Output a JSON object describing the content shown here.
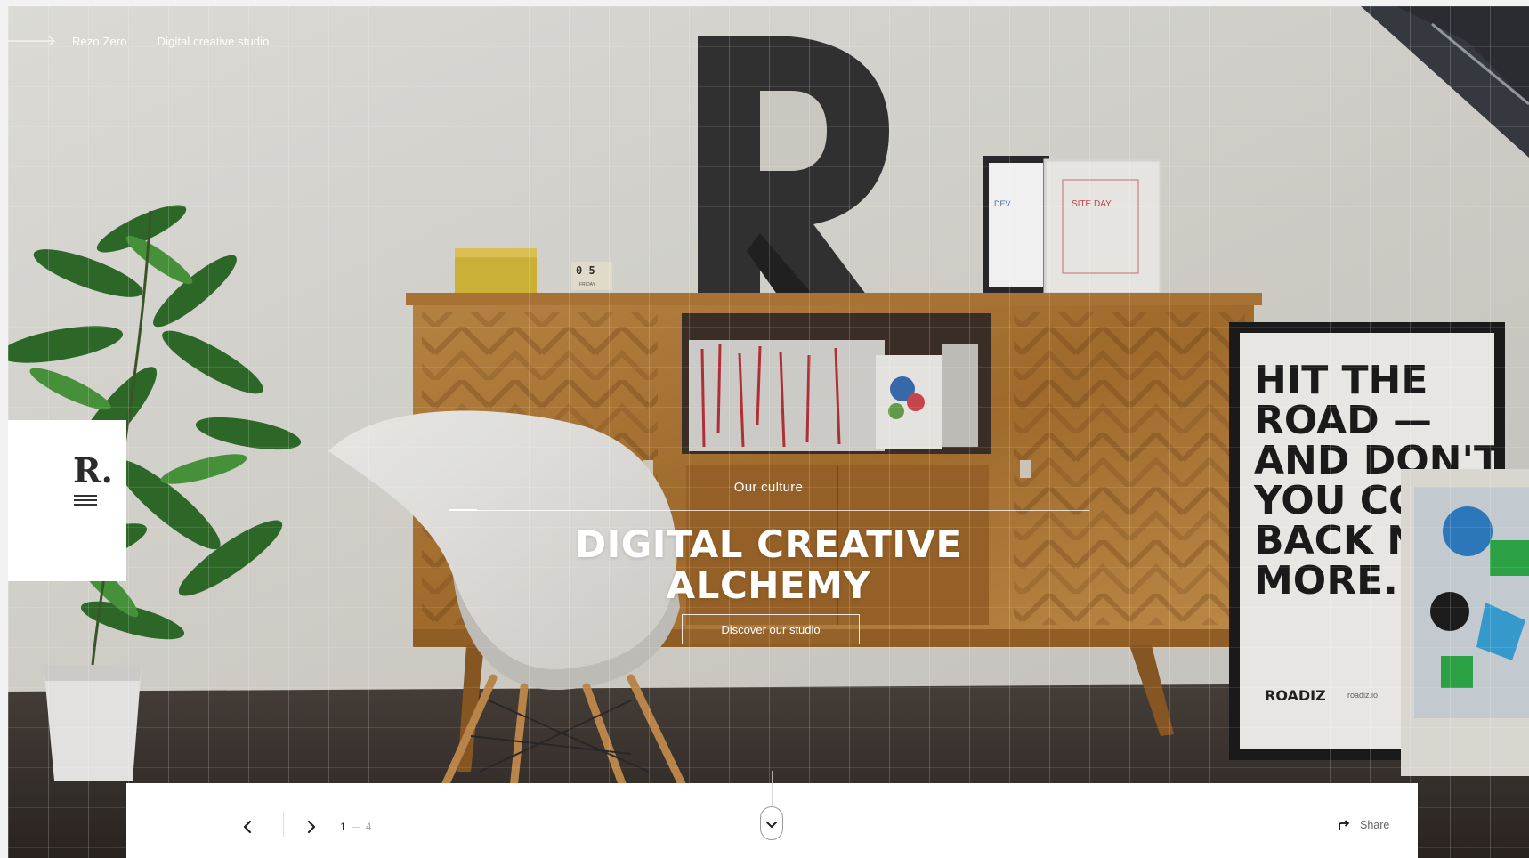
{
  "breadcrumb": {
    "items": [
      {
        "label": "Rezo Zero"
      },
      {
        "label": "Digital creative studio"
      }
    ]
  },
  "logo": {
    "mark": "R."
  },
  "hero": {
    "kicker": "Our culture",
    "title_line1": "DIGITAL CREATIVE",
    "title_line2": "ALCHEMY",
    "cta_label": "Discover our studio",
    "poster_lines": [
      "HIT THE",
      "ROAD",
      "AND DON'T",
      "YOU CO",
      "BACK N",
      "MORE."
    ],
    "poster_brand": "ROADIZ",
    "poster_url": "roadiz.io",
    "calendar_date": "0 5",
    "calendar_day": "FRIDAY"
  },
  "pager": {
    "current": "1",
    "total": "4"
  },
  "share": {
    "label": "Share"
  },
  "colors": {
    "wall": "#dedcd6",
    "floor": "#3a3430",
    "wood": "#b07a3a",
    "panel": "#ffffff",
    "text_dark": "#2b2b2b"
  }
}
